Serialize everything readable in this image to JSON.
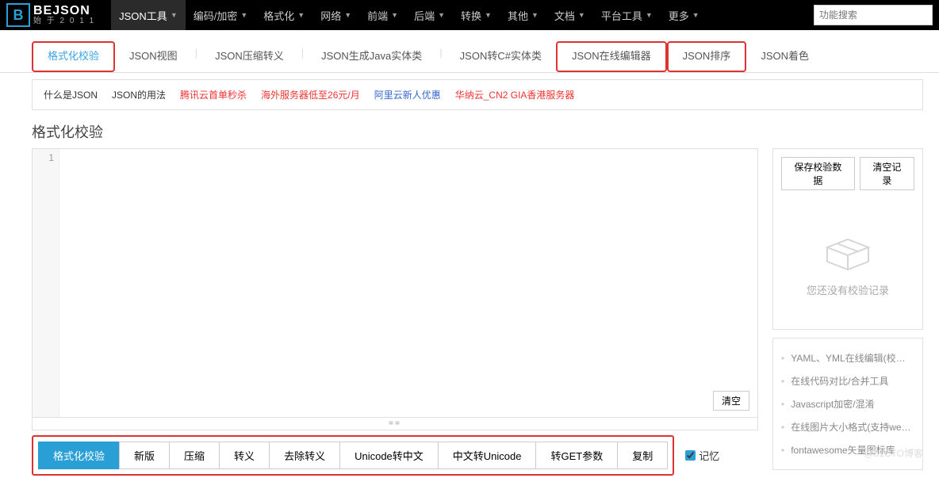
{
  "logo": {
    "mark": "B",
    "text": "BEJSON",
    "sub": "始 于 2 0 1 1"
  },
  "topnav": {
    "items": [
      {
        "label": "JSON工具",
        "active": true
      },
      {
        "label": "编码/加密"
      },
      {
        "label": "格式化"
      },
      {
        "label": "网络"
      },
      {
        "label": "前端"
      },
      {
        "label": "后端"
      },
      {
        "label": "转换"
      },
      {
        "label": "其他"
      },
      {
        "label": "文档"
      },
      {
        "label": "平台工具"
      },
      {
        "label": "更多"
      }
    ],
    "search_placeholder": "功能搜索"
  },
  "tabs": [
    {
      "label": "格式化校验",
      "active": true,
      "highlight": true
    },
    {
      "label": "JSON视图"
    },
    {
      "label": "JSON压缩转义"
    },
    {
      "label": "JSON生成Java实体类"
    },
    {
      "label": "JSON转C#实体类"
    },
    {
      "label": "JSON在线编辑器",
      "highlight": true
    },
    {
      "label": "JSON排序",
      "highlight": true
    },
    {
      "label": "JSON着色"
    }
  ],
  "links": [
    {
      "label": "什么是JSON",
      "cls": "lk-black"
    },
    {
      "label": "JSON的用法",
      "cls": "lk-black"
    },
    {
      "label": "腾讯云首单秒杀",
      "cls": "lk-red"
    },
    {
      "label": "海外服务器低至26元/月",
      "cls": "lk-red"
    },
    {
      "label": "阿里云新人优惠",
      "cls": "lk-blue"
    },
    {
      "label": "华纳云_CN2 GIA香港服务器",
      "cls": "lk-red"
    }
  ],
  "page_title": "格式化校验",
  "editor": {
    "line1": "1",
    "clear_label": "清空"
  },
  "actions": [
    {
      "label": "格式化校验",
      "primary": true
    },
    {
      "label": "新版"
    },
    {
      "label": "压缩"
    },
    {
      "label": "转义"
    },
    {
      "label": "去除转义"
    },
    {
      "label": "Unicode转中文"
    },
    {
      "label": "中文转Unicode"
    },
    {
      "label": "转GET参数"
    },
    {
      "label": "复制"
    }
  ],
  "memory_label": "记忆",
  "right": {
    "save_label": "保存校验数据",
    "clear_history_label": "清空记录",
    "empty_text": "您还没有校验记录",
    "related": [
      "YAML、YML在线编辑(校验)器",
      "在线代码对比/合并工具",
      "Javascript加密/混淆",
      "在线图片大小格式(支持webp...",
      "fontawesome矢量图标库"
    ]
  },
  "watermark": "@51CTO博客"
}
